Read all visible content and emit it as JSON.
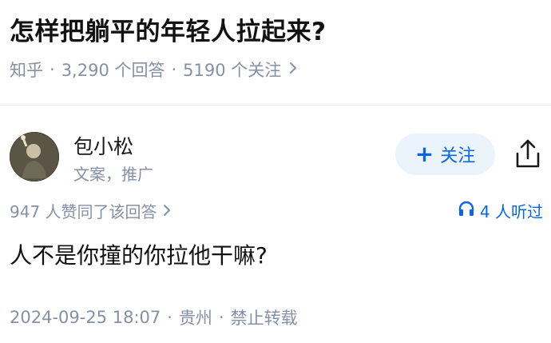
{
  "question": {
    "title": "怎样把躺平的年轻人拉起来?",
    "source": "知乎",
    "answers_count": "3,290 个回答",
    "followers_count": "5190 个关注",
    "chevron": "chevron-right-icon"
  },
  "author": {
    "name": "包小松",
    "bio": "文案，推广",
    "follow_label": "关注",
    "follow_plus": "+",
    "share_icon": "share-icon"
  },
  "stats": {
    "votes": "947 人赞同了该回答",
    "listeners": "4 人听过",
    "listen_icon": "headphones-icon"
  },
  "answer": {
    "content": "人不是你撞的你拉他干嘛?"
  },
  "footer": {
    "datetime": "2024-09-25 18:07",
    "location": "贵州",
    "copyright": "禁止转载"
  },
  "colors": {
    "accent": "#0a66e6",
    "meta_gray": "#8590a6",
    "follow_bg": "#ebf3fd"
  }
}
